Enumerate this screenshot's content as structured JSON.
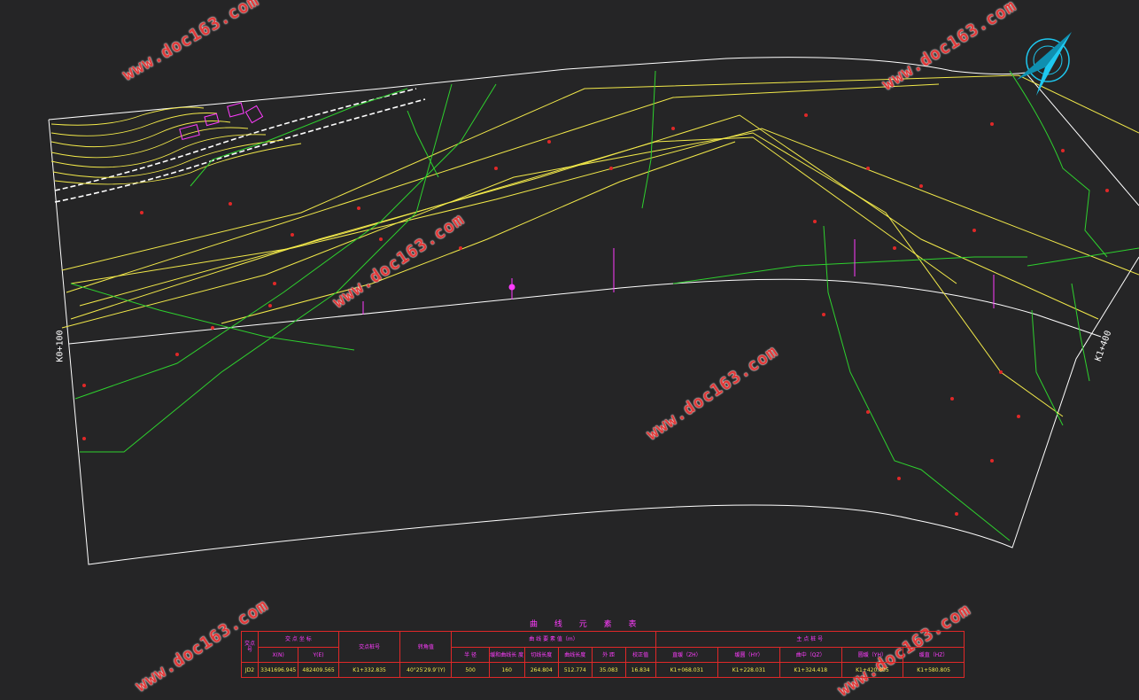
{
  "stakes": {
    "start": "K0+100",
    "end": "K1+400"
  },
  "watermark": "www.doc163.com",
  "table": {
    "title": "曲 线 元 素 表",
    "group_headers": {
      "no": "交点号",
      "coords": "交 点 坐 标",
      "jd_stake": "交点桩号",
      "angle": "转角值",
      "elements": "曲 线 要 素 值（m）",
      "main_points": "主 点 桩 号"
    },
    "sub_headers": {
      "x": "X(N)",
      "y": "Y(E)",
      "radius": "半 径",
      "spiral": "缓和曲线长 度",
      "tangent": "切线长度",
      "curve_len": "曲线长度",
      "external": "外 距",
      "correction": "校正值",
      "zh": "直缓（ZH）",
      "hy": "缓圆（HY）",
      "qz": "曲中（QZ）",
      "yh": "圆缓（YH）",
      "hz": "缓直（HZ）"
    },
    "row": {
      "no": "JD2",
      "x": "3341696.945",
      "y": "482409.565",
      "jd_stake": "K1+332.835",
      "angle": "40°25′29.9″(Y)",
      "radius": "500",
      "spiral": "160",
      "tangent": "264.804",
      "curve_len": "512.774",
      "external": "35.083",
      "correction": "16.834",
      "zh": "K1+068.031",
      "hy": "K1+228.031",
      "qz": "K1+324.418",
      "yh": "K1+420.805",
      "hz": "K1+580.805"
    }
  },
  "colors": {
    "background": "#252526",
    "boundary": "#ffffff",
    "contour": "#f2e94a",
    "terrain_lines": "#2ed12e",
    "elevation_text": "#e02828",
    "annotation": "#ff3cff",
    "north_arrow": "#1ec8f0",
    "table_border": "#e02828"
  },
  "icons": {
    "north_arrow": "north-arrow-icon"
  }
}
